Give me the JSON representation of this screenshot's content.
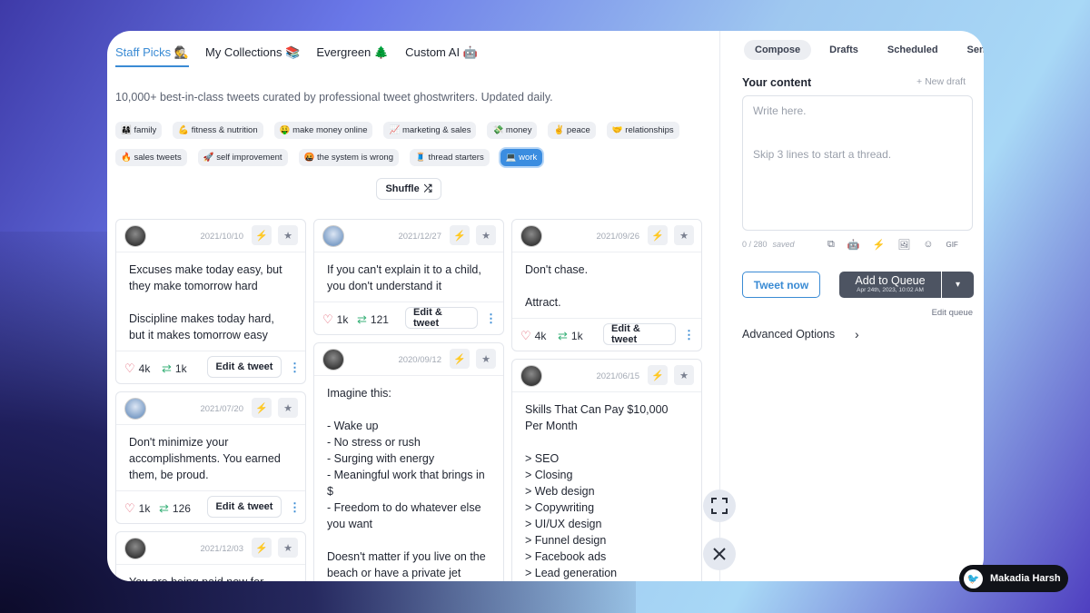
{
  "tabs": [
    {
      "label": "Staff Picks 🕵️"
    },
    {
      "label": "My Collections 📚"
    },
    {
      "label": "Evergreen 🌲"
    },
    {
      "label": "Custom AI 🤖"
    }
  ],
  "description": "10,000+ best-in-class tweets curated by professional tweet ghostwriters. Updated daily.",
  "chips_row1": [
    "👨‍👩‍👧 family",
    "💪 fitness & nutrition",
    "🤑 make money online",
    "📈 marketing & sales",
    "💸 money",
    "✌️ peace",
    "🤝 relationships"
  ],
  "chips_row2": [
    "🔥 sales tweets",
    "🚀 self improvement",
    "🤬 the system is wrong",
    "🧵 thread starters",
    "💻 work"
  ],
  "shuffle_label": "Shuffle",
  "shuffle_icon": "⤮",
  "edit_label": "Edit & tweet",
  "cards": [
    {
      "date": "2021/10/10",
      "text": "Excuses make today easy, but they make tomorrow hard\n\nDiscipline makes today hard, but it makes tomorrow easy",
      "likes": "4k",
      "retweets": "1k"
    },
    {
      "date": "2021/07/20",
      "text": "Don't minimize your accomplishments. You earned them, be proud.",
      "likes": "1k",
      "retweets": "126"
    },
    {
      "date": "2021/12/03",
      "text": "You are being paid now for where"
    },
    {
      "date": "2021/12/27",
      "text": "If you can't explain it to a child, you don't understand it",
      "likes": "1k",
      "retweets": "121"
    },
    {
      "date": "2020/09/12",
      "text": "Imagine this:\n\n- Wake up\n- No stress or rush\n- Surging with energy\n- Meaningful work that brings in $\n- Freedom to do whatever else you want\n\nDoesn't matter if you live on the beach or have a private jet"
    },
    {
      "date": "2021/09/26",
      "text": "Don't chase.\n\nAttract.",
      "likes": "4k",
      "retweets": "1k"
    },
    {
      "date": "2021/06/15",
      "text": "Skills That Can Pay $10,000 Per Month\n\n> SEO\n> Closing\n> Web design\n> Copywriting\n> UI/UX design\n> Funnel design\n> Facebook ads\n> Lead generation"
    }
  ],
  "right": {
    "tabs": [
      "Compose",
      "Drafts",
      "Scheduled",
      "Sent"
    ],
    "your_content": "Your content",
    "new_draft": "+ New draft",
    "placeholder": "Write here.\n\n\nSkip 3 lines to start a thread.",
    "counter": "0 / 280",
    "saved": "saved",
    "tools": [
      "⧉",
      "🤖",
      "⚡",
      "🖼",
      "☺",
      "GIF"
    ],
    "tweet_now": "Tweet now",
    "add_queue": "Add to Queue",
    "queue_time": "Apr 24th, 2023, 10:02 AM",
    "edit_queue": "Edit queue",
    "advanced": "Advanced Options"
  },
  "badge_name": "Makadia Harsh",
  "colors": {
    "accent": "#3a8bd4",
    "like": "#e0566a",
    "retweet": "#3bb27a",
    "queue_bg": "#4d5462"
  }
}
